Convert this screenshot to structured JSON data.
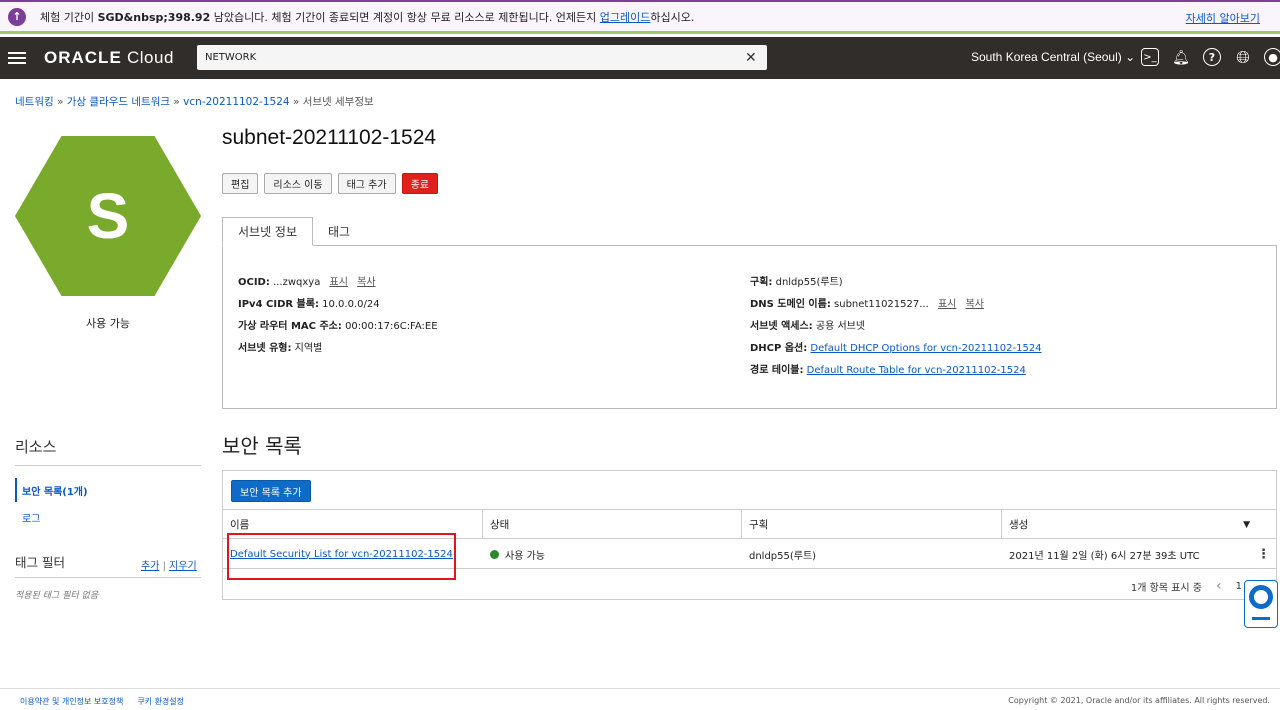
{
  "banner": {
    "message_prefix": "체험 기간이 ",
    "amount": "SGD&nbsp;398.92",
    "message_mid": " 남았습니다. 체험 기간이 종료되면 계정이 항상 무료 리소스로 제한됩니다. 언제든지 ",
    "upgrade_link": "업그레이드",
    "message_suffix": "하십시오.",
    "more_link": "자세히 알아보기"
  },
  "topbar": {
    "logo_bold": "ORACLE",
    "logo_rest": " Cloud",
    "search_value": "NETWORK",
    "region": "South Korea Central (Seoul)"
  },
  "breadcrumb": {
    "items": [
      "네트워킹",
      "가상 클라우드 네트워크",
      "vcn-20211102-1524"
    ],
    "current": "서브넷 세부정보",
    "separator": "»"
  },
  "subnet": {
    "icon_letter": "S",
    "status": "사용 가능",
    "title": "subnet-20211102-1524"
  },
  "actions": {
    "edit": "편집",
    "move": "리소스 이동",
    "add_tag": "태그 추가",
    "terminate": "종료"
  },
  "tabs": [
    "서브넷 정보",
    "태그"
  ],
  "info": {
    "ocid_label": "OCID:",
    "ocid_value": "...zwqxya",
    "show": "표시",
    "copy": "복사",
    "cidr_label": "IPv4 CIDR 블록:",
    "cidr_value": "10.0.0.0/24",
    "mac_label": "가상 라우터 MAC 주소:",
    "mac_value": "00:00:17:6C:FA:EE",
    "type_label": "서브넷 유형:",
    "type_value": "지역별",
    "compartment_label": "구획:",
    "compartment_value": "dnldp55(루트)",
    "dns_label": "DNS 도메인 이름:",
    "dns_value": "subnet11021527...",
    "access_label": "서브넷 액세스:",
    "access_value": "공용 서브넷",
    "dhcp_label": "DHCP 옵션:",
    "dhcp_value": "Default DHCP Options for vcn-20211102-1524",
    "route_label": "경로 테이블:",
    "route_value": "Default Route Table for vcn-20211102-1524"
  },
  "resources": {
    "title": "리소스",
    "security_lists": "보안 목록(1개)",
    "logs": "로그"
  },
  "tag_filter": {
    "title": "태그 필터",
    "add": "추가",
    "separator": "|",
    "clear": "지우기",
    "empty": "적용된 태그 필터 없음"
  },
  "security": {
    "title": "보안 목록",
    "add_button": "보안 목록 추가",
    "columns": [
      "이름",
      "상태",
      "구획",
      "생성"
    ],
    "rows": [
      {
        "name": "Default Security List for vcn-20211102-1524",
        "status": "사용 가능",
        "compartment": "dnldp55(루트)",
        "created": "2021년 11월 2일 (화) 6시 27분 39초 UTC"
      }
    ],
    "pager_text": "1개 항목 표시 중",
    "pager_page": "1"
  },
  "footer": {
    "terms": "이용약관 및 개인정보 보호정책",
    "cookies": "쿠키 환경설정",
    "copyright": "Copyright © 2021, Oracle and/or its affiliates. All rights reserved."
  },
  "colors": {
    "banner_accent": "#7b3f98",
    "topbar_bg": "#312d2a",
    "hex_green": "#7aaa2b",
    "primary_blue": "#0e6bc7",
    "danger_red": "#e0201b",
    "highlight_red": "#e3141b"
  }
}
